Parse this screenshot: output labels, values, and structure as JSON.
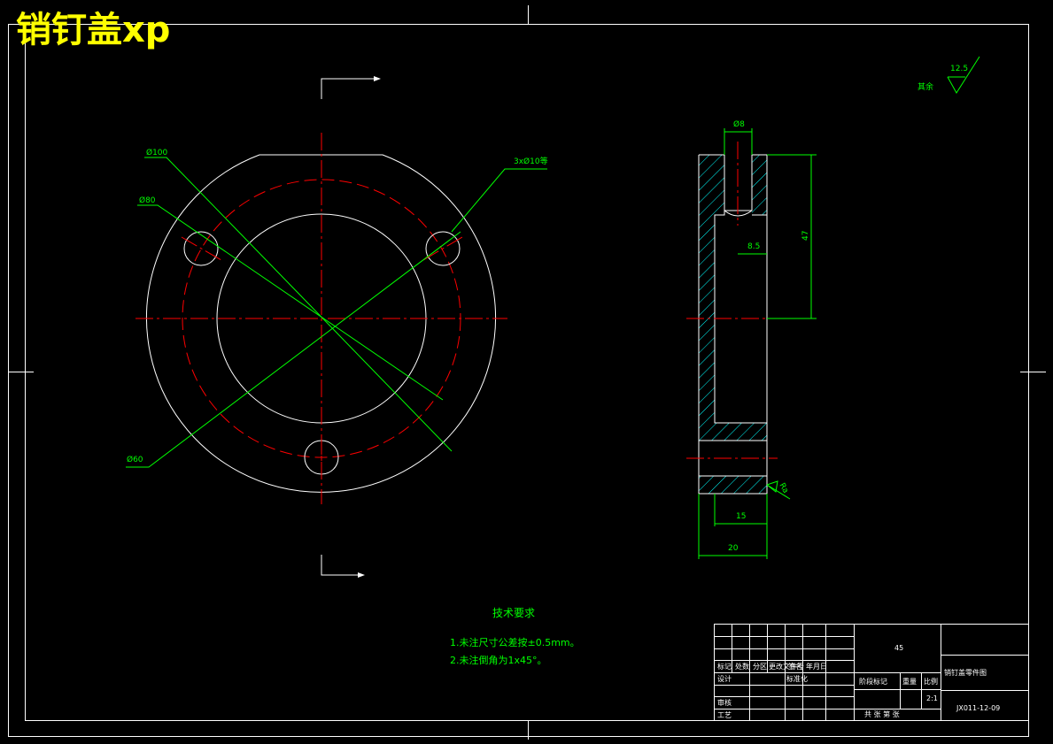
{
  "title": "销钉盖xp",
  "dimensions": {
    "d100": "Ø100",
    "d80": "Ø80",
    "d60": "Ø60",
    "holes": "3xØ10等",
    "d8": "Ø8",
    "h47": "47",
    "w8_5": "8.5",
    "w15": "15",
    "w20": "20",
    "chamfer_note": "Ra",
    "roughness_value": "12.5",
    "roughness_label": "其余"
  },
  "tech_requirements": {
    "heading": "技术要求",
    "items": [
      "1.未注尺寸公差按±0.5mm。",
      "2.未注倒角为1x45°。"
    ]
  },
  "title_block": {
    "material": "45",
    "part_name": "销钉盖零件图",
    "drawing_number": "JX011-12-09",
    "scale_value": "2:1",
    "row_labels": [
      "标记",
      "处数",
      "分区",
      "更改文件号",
      "签名",
      "年月日"
    ],
    "designer_label": "设计",
    "standard_label": "标准化",
    "checker_label": "审核",
    "process_label": "工艺",
    "stage_label": "阶段标记",
    "weight_label": "重量",
    "ratio_label": "比例",
    "sheet_label": "共  张  第  张"
  },
  "colors": {
    "background": "#000000",
    "outline": "#ffffff",
    "centerline": "#ff0000",
    "dimension": "#00ff00",
    "hatch": "#00ffff",
    "title": "#ffff00"
  }
}
